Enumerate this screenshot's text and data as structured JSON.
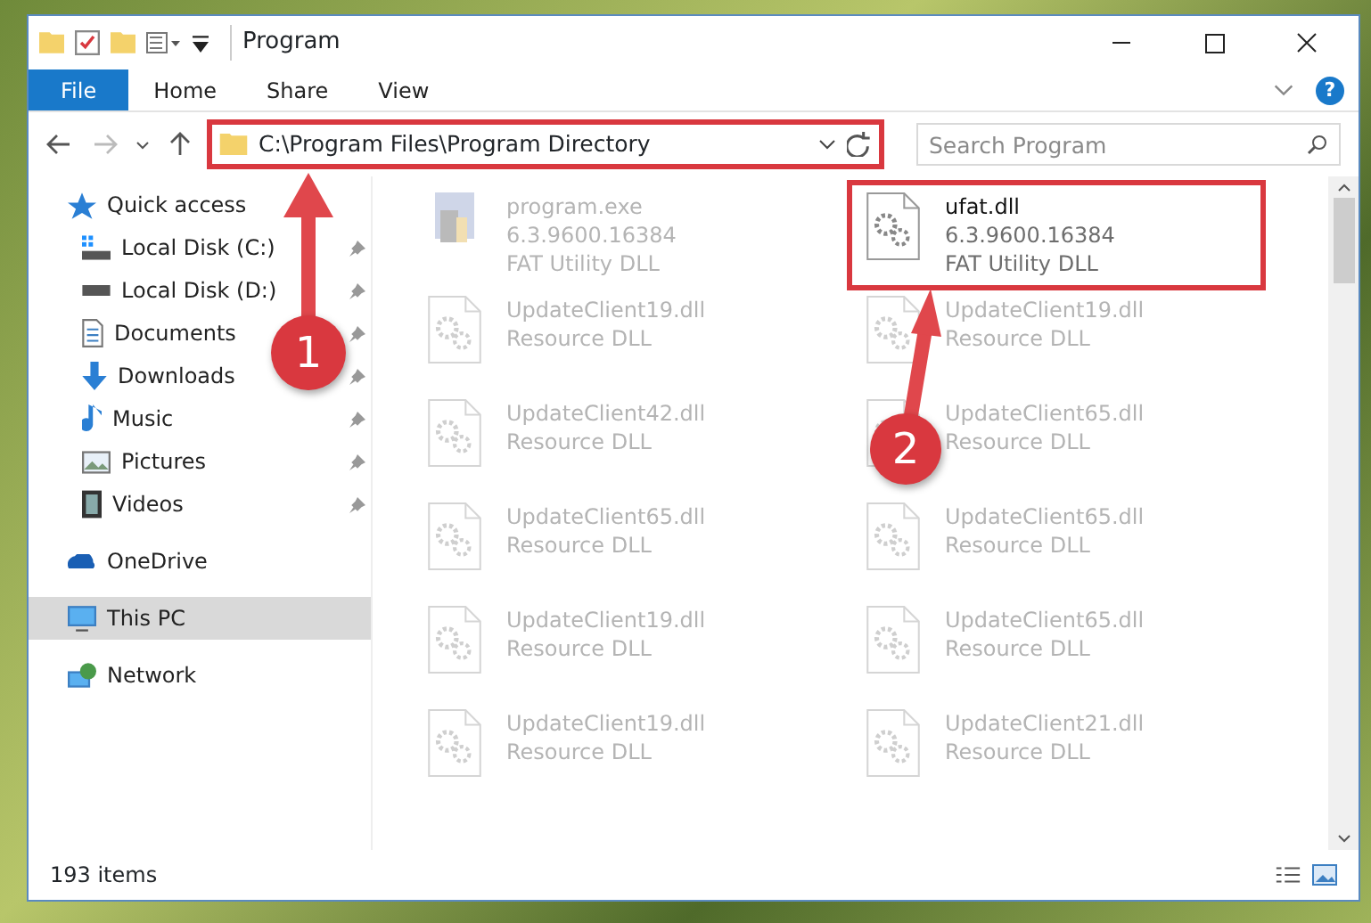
{
  "window": {
    "title": "Program"
  },
  "ribbon": {
    "tabs": [
      {
        "label": "File",
        "selected": true
      },
      {
        "label": "Home",
        "selected": false
      },
      {
        "label": "Share",
        "selected": false
      },
      {
        "label": "View",
        "selected": false
      }
    ],
    "help": "?"
  },
  "address": {
    "path": "C:\\Program Files\\Program Directory",
    "highlighted": true
  },
  "search": {
    "placeholder": "Search Program"
  },
  "sidebar": {
    "items": [
      {
        "label": "Quick access",
        "kind": "star",
        "selected": false,
        "children": [
          {
            "label": "Local Disk (C:)",
            "kind": "drive-win",
            "pinned": true
          },
          {
            "label": "Local Disk (D:)",
            "kind": "drive",
            "pinned": true
          },
          {
            "label": "Documents",
            "kind": "document",
            "pinned": true
          },
          {
            "label": "Downloads",
            "kind": "download",
            "pinned": true
          },
          {
            "label": "Music",
            "kind": "music",
            "pinned": true
          },
          {
            "label": "Pictures",
            "kind": "picture",
            "pinned": true
          },
          {
            "label": "Videos",
            "kind": "video",
            "pinned": true
          }
        ]
      },
      {
        "label": "OneDrive",
        "kind": "cloud",
        "selected": false
      },
      {
        "label": "This PC",
        "kind": "pc",
        "selected": true
      },
      {
        "label": "Network",
        "kind": "network",
        "selected": false
      }
    ]
  },
  "files": [
    {
      "kind": "exe",
      "name": "program.exe",
      "lines": [
        "6.3.9600.16384",
        "FAT Utility DLL"
      ],
      "dimmed": true,
      "highlighted": false
    },
    {
      "kind": "dll",
      "name": "ufat.dll",
      "lines": [
        "6.3.9600.16384",
        "FAT Utility DLL"
      ],
      "dimmed": false,
      "highlighted": true
    },
    {
      "kind": "dll",
      "name": "UpdateClient19.dll",
      "lines": [
        "Resource DLL"
      ],
      "dimmed": true,
      "highlighted": false
    },
    {
      "kind": "dll",
      "name": "UpdateClient19.dll",
      "lines": [
        "Resource DLL"
      ],
      "dimmed": true,
      "highlighted": false
    },
    {
      "kind": "dll",
      "name": "UpdateClient42.dll",
      "lines": [
        "Resource DLL"
      ],
      "dimmed": true,
      "highlighted": false
    },
    {
      "kind": "dll",
      "name": "UpdateClient65.dll",
      "lines": [
        "Resource DLL"
      ],
      "dimmed": true,
      "highlighted": false
    },
    {
      "kind": "dll",
      "name": "UpdateClient65.dll",
      "lines": [
        "Resource DLL"
      ],
      "dimmed": true,
      "highlighted": false
    },
    {
      "kind": "dll",
      "name": "UpdateClient65.dll",
      "lines": [
        "Resource DLL"
      ],
      "dimmed": true,
      "highlighted": false
    },
    {
      "kind": "dll",
      "name": "UpdateClient19.dll",
      "lines": [
        "Resource DLL"
      ],
      "dimmed": true,
      "highlighted": false
    },
    {
      "kind": "dll",
      "name": "UpdateClient65.dll",
      "lines": [
        "Resource DLL"
      ],
      "dimmed": true,
      "highlighted": false
    },
    {
      "kind": "dll",
      "name": "UpdateClient19.dll",
      "lines": [
        "Resource DLL"
      ],
      "dimmed": true,
      "highlighted": false
    },
    {
      "kind": "dll",
      "name": "UpdateClient21.dll",
      "lines": [
        "Resource DLL"
      ],
      "dimmed": true,
      "highlighted": false
    }
  ],
  "status_bar": {
    "count": "193 items"
  },
  "annotations": [
    {
      "number": "1"
    },
    {
      "number": "2"
    }
  ]
}
